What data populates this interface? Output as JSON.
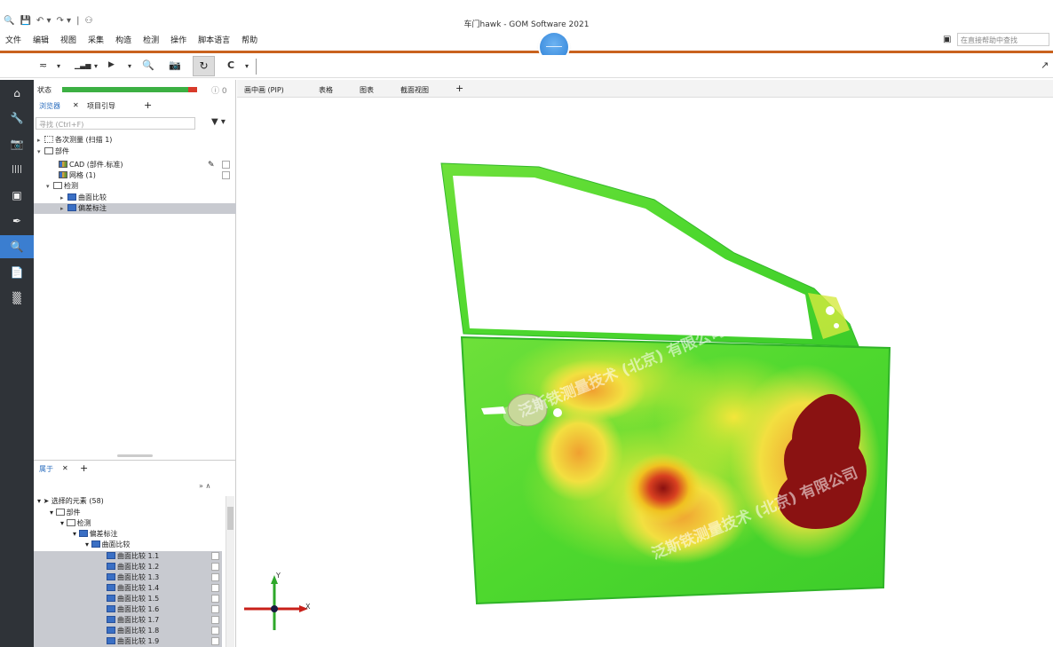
{
  "window": {
    "title": "车门hawk - GOM Software 2021",
    "quick_access": [
      "🔍",
      "💾",
      "↶ ▾",
      "↷ ▾",
      "|",
      "⚇"
    ]
  },
  "menu": [
    "文件",
    "编辑",
    "视图",
    "采集",
    "构造",
    "检测",
    "操作",
    "脚本语言",
    "帮助"
  ],
  "help_search": {
    "placeholder": "在直接帮助中查找"
  },
  "toolbar": {
    "tools": [
      "≂",
      "▾",
      "▁▃▅",
      "▾",
      "▶",
      "▾",
      "🔍",
      "📷"
    ],
    "sync_icon": "↻",
    "refresh_icon": "C",
    "refresh_menu": "▾",
    "right_icon": "↗"
  },
  "sidebar_icons": [
    "home-icon",
    "wrench-icon",
    "camera-icon",
    "ruler-icon",
    "video-icon",
    "pen-icon",
    "search-icon",
    "report-icon",
    "checker-icon"
  ],
  "sidebar_glyphs": [
    "⌂",
    "🔧",
    "📷",
    "||||",
    "▣",
    "✒",
    "🔍",
    "📄",
    "▒"
  ],
  "explorer": {
    "status_label": "状态",
    "status_count": "ⓘ 0",
    "tabs": [
      "浏览器",
      "✕",
      "项目引导",
      "+"
    ],
    "search_placeholder": "寻找 (Ctrl+F)",
    "filter_icon": "▼ ▾",
    "tree": [
      {
        "exp": "▸",
        "label": "各次测量 (扫描 1)",
        "indent": 0,
        "icon": "dots",
        "sel": false
      },
      {
        "exp": "▾",
        "label": "部件",
        "indent": 0,
        "icon": "box",
        "sel": false
      },
      {
        "exp": "",
        "label": "CAD (部件.标准)",
        "indent": 2,
        "icon": "multi",
        "sel": false
      },
      {
        "exp": "",
        "label": "网格 (1)",
        "indent": 2,
        "icon": "multi",
        "sel": false
      },
      {
        "exp": "▾",
        "label": "检测",
        "indent": 1,
        "icon": "folder",
        "sel": false
      },
      {
        "exp": "▸",
        "label": "曲面比较",
        "indent": 3,
        "icon": "blue",
        "sel": false
      },
      {
        "exp": "▸",
        "label": "偏差标注",
        "indent": 3,
        "icon": "blue",
        "sel": true
      }
    ]
  },
  "properties": {
    "tabs": [
      "属于",
      "✕",
      "+"
    ],
    "arrows": "»   ∧",
    "rows": [
      {
        "exp": "▾",
        "label": "选择的元素 (58)",
        "indent": 0,
        "sel": false
      },
      {
        "exp": "▾",
        "label": "部件",
        "indent": 1,
        "sel": false
      },
      {
        "exp": "▾",
        "label": "检测",
        "indent": 2,
        "sel": false
      },
      {
        "exp": "▾",
        "label": "偏差标注",
        "indent": 3,
        "sel": false
      },
      {
        "exp": "▾",
        "label": "曲面比较",
        "indent": 4,
        "sel": false
      },
      {
        "exp": "",
        "label": "曲面比较 1.1",
        "indent": 6,
        "sel": true
      },
      {
        "exp": "",
        "label": "曲面比较 1.2",
        "indent": 6,
        "sel": true
      },
      {
        "exp": "",
        "label": "曲面比较 1.3",
        "indent": 6,
        "sel": true
      },
      {
        "exp": "",
        "label": "曲面比较 1.4",
        "indent": 6,
        "sel": true
      },
      {
        "exp": "",
        "label": "曲面比较 1.5",
        "indent": 6,
        "sel": true
      },
      {
        "exp": "",
        "label": "曲面比较 1.6",
        "indent": 6,
        "sel": true
      },
      {
        "exp": "",
        "label": "曲面比较 1.7",
        "indent": 6,
        "sel": true
      },
      {
        "exp": "",
        "label": "曲面比较 1.8",
        "indent": 6,
        "sel": true
      },
      {
        "exp": "",
        "label": "曲面比较 1.9",
        "indent": 6,
        "sel": true
      }
    ]
  },
  "viewport": {
    "tabs": [
      "画中画 (PIP)",
      "表格",
      "图表",
      "截面视图",
      "+"
    ],
    "axis_y": "Y",
    "axis_x": "X",
    "watermark": [
      "泛斯铁测量技术 (北京) 有限公司",
      "泛斯铁测量技术 (北京) 有限公司"
    ]
  }
}
